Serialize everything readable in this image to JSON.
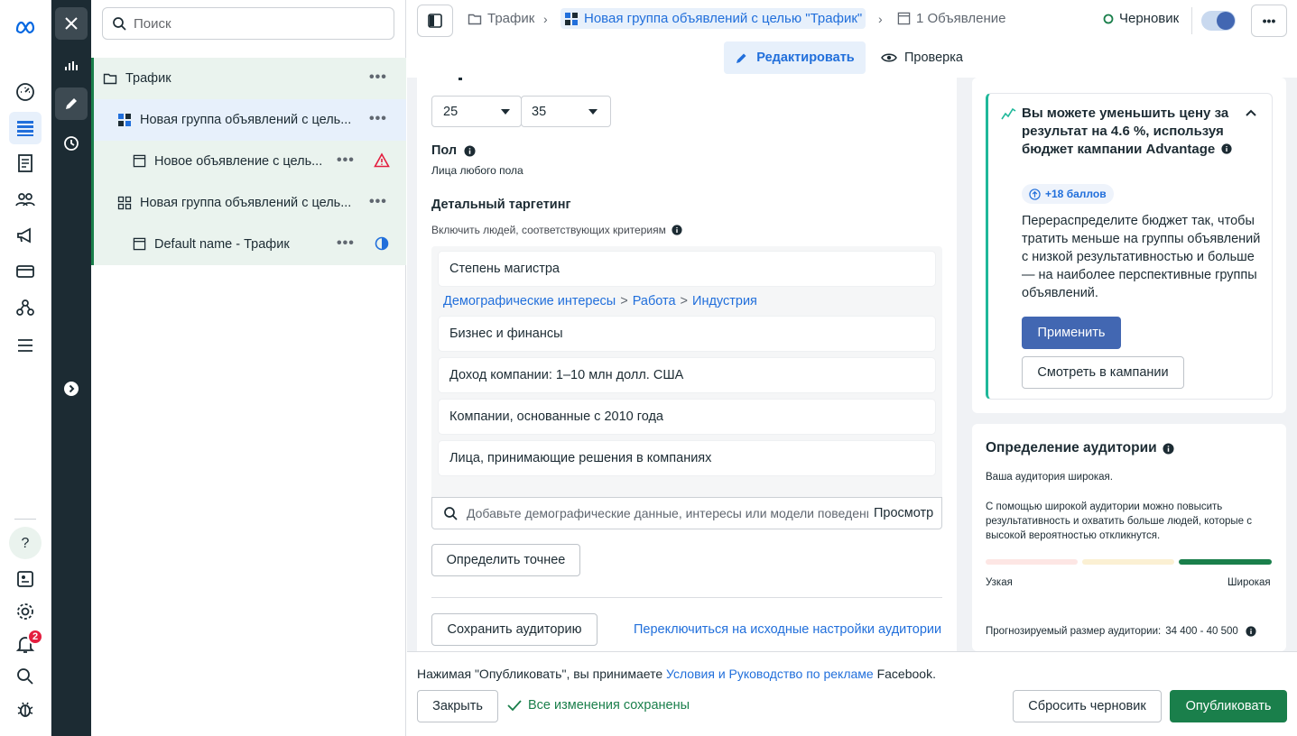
{
  "search": {
    "placeholder": "Поиск"
  },
  "tree": {
    "items": [
      {
        "label": "Трафик"
      },
      {
        "label": "Новая группа объявлений с цель..."
      },
      {
        "label": "Новое объявление с цель..."
      },
      {
        "label": "Новая группа объявлений с цель..."
      },
      {
        "label": "Default name - Трафик"
      }
    ],
    "more": "•••"
  },
  "breadcrumb": {
    "campaign": "Трафик",
    "adset": "Новая группа объявлений с целью \"Трафик\"",
    "ads": "1 Объявление",
    "status": "Черновик",
    "more": "•••"
  },
  "mode_tabs": {
    "edit": "Редактировать",
    "review": "Проверка"
  },
  "age": {
    "min": "25",
    "max": "35"
  },
  "gender": {
    "title": "Пол",
    "value": "Лица любого пола"
  },
  "targeting": {
    "title": "Детальный таргетинг",
    "include_label": "Включить людей, соответствующих критериям",
    "first_item": "Степень магистра",
    "path": {
      "a": "Демографические интересы",
      "sep": ">",
      "b": "Работа",
      "c": "Индустрия"
    },
    "items": [
      "Бизнес и финансы",
      "Доход компании: 1–10 млн долл. США",
      "Компании, основанные с 2010 года",
      "Лица, принимающие решения в компаниях"
    ],
    "search_placeholder": "Добавьте демографические данные, интересы или модели поведения",
    "browse": "Просмотр",
    "narrow_button": "Определить точнее"
  },
  "audience_actions": {
    "save": "Сохранить аудиторию",
    "switch_link": "Переключиться на исходные настройки аудитории"
  },
  "tip": {
    "title": "Вы можете уменьшить цену за результат на 4.6 %, используя бюджет кампании Advantage",
    "points": "+18 баллов",
    "body": "Перераспределите бюджет так, чтобы тратить меньше на группы объявлений с низкой результативностью и больше — на наиболее перспективные группы объявлений.",
    "apply": "Применить",
    "view": "Смотреть в кампании"
  },
  "audience_def": {
    "title": "Определение аудитории",
    "status": "Ваша аудитория широкая.",
    "desc": "С помощью широкой аудитории можно повысить результативность и охватить больше людей, которые с высокой вероятностью откликнутся.",
    "narrow": "Узкая",
    "wide": "Широкая",
    "estimate_label": "Прогнозируемый размер аудитории:",
    "estimate_value": "34 400 - 40 500"
  },
  "footer": {
    "notice_pre": "Нажимая \"Опубликовать\", вы принимаете",
    "notice_link": "Условия и Руководство по рекламе",
    "notice_post": "Facebook.",
    "close": "Закрыть",
    "saved": "Все изменения сохранены",
    "discard": "Сбросить черновик",
    "publish": "Опубликовать"
  },
  "notifications": {
    "count": "2"
  },
  "colors": {
    "accent": "#216fdb",
    "publish": "#1a7f4b",
    "apply": "#4267b2",
    "toolbar_dark": "#1c2b33",
    "selected_bg": "#e7f0fb",
    "tree_bg": "#eaf3ee"
  }
}
